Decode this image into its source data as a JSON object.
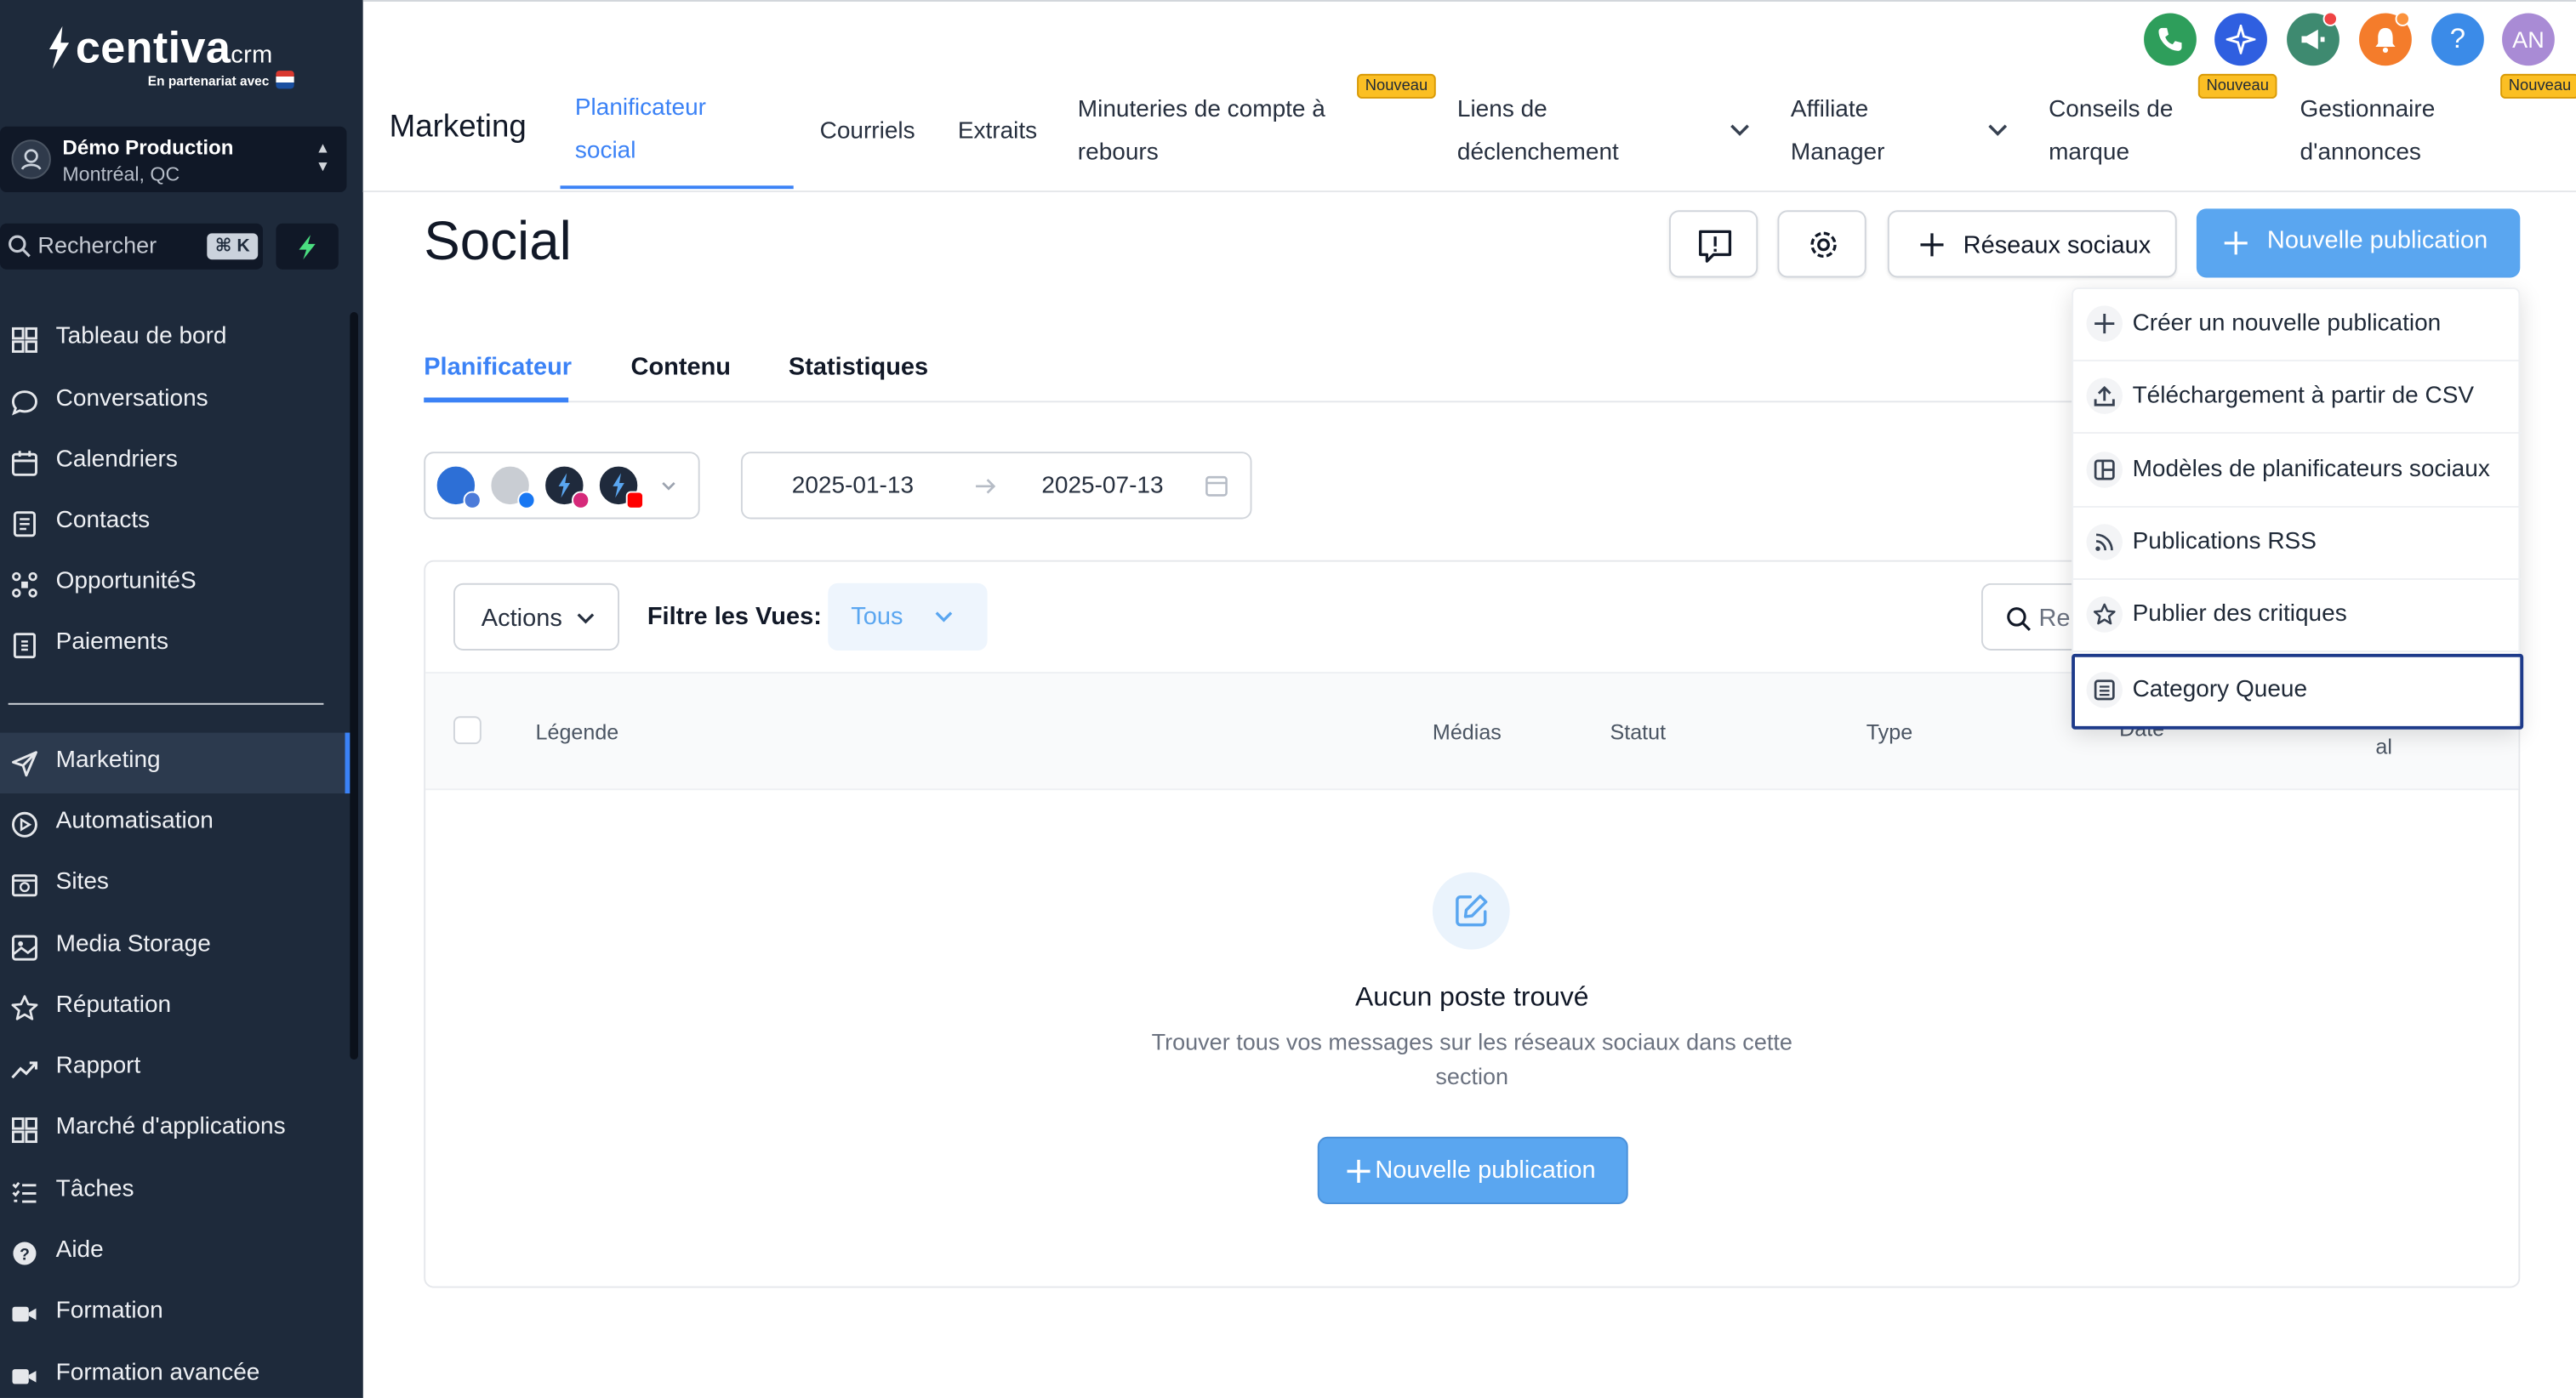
{
  "brand": {
    "name": "centiva",
    "suffix": "crm",
    "tagline": "En partenariat avec"
  },
  "account": {
    "name": "Démo Production",
    "location": "Montréal, QC"
  },
  "search": {
    "label": "Rechercher",
    "shortcut": "⌘ K"
  },
  "sidebar": {
    "items": [
      {
        "label": "Tableau de bord",
        "icon": "dashboard-icon"
      },
      {
        "label": "Conversations",
        "icon": "chat-icon"
      },
      {
        "label": "Calendriers",
        "icon": "calendar-icon"
      },
      {
        "label": "Contacts",
        "icon": "contacts-icon"
      },
      {
        "label": "OpportunitéS",
        "icon": "opportunities-icon"
      },
      {
        "label": "Paiements",
        "icon": "payments-icon"
      },
      {
        "label": "Marketing",
        "icon": "send-icon",
        "active": true
      },
      {
        "label": "Automatisation",
        "icon": "automation-icon"
      },
      {
        "label": "Sites",
        "icon": "sites-icon"
      },
      {
        "label": "Media Storage",
        "icon": "image-icon"
      },
      {
        "label": "Réputation",
        "icon": "star-icon"
      },
      {
        "label": "Rapport",
        "icon": "trend-icon"
      },
      {
        "label": "Marché d'applications",
        "icon": "apps-icon"
      },
      {
        "label": "Tâches",
        "icon": "tasks-icon"
      },
      {
        "label": "Aide",
        "icon": "help-icon"
      },
      {
        "label": "Formation",
        "icon": "video-icon"
      },
      {
        "label": "Formation avancée",
        "icon": "video-icon"
      }
    ]
  },
  "header": {
    "section_title": "Marketing",
    "tabs": [
      {
        "label": "Planificateur social",
        "active": true
      },
      {
        "label": "Courriels"
      },
      {
        "label": "Extraits"
      },
      {
        "label": "Minuteries de compte à rebours",
        "badge": "Nouveau"
      },
      {
        "label": "Liens de déclenchement",
        "dropdown": true
      },
      {
        "label": "Affiliate Manager",
        "dropdown": true
      },
      {
        "label": "Conseils de marque",
        "badge": "Nouveau"
      },
      {
        "label": "Gestionnaire d'annonces",
        "badge": "Nouveau"
      }
    ],
    "user_initials": "AN",
    "colors": {
      "phone": "#2e9e5b",
      "ai": "#2f5fe0",
      "megaphone": "#3e8a70",
      "bell": "#f47c2b",
      "help": "#3b8be8",
      "avatar": "#a98bd5"
    }
  },
  "page": {
    "title": "Social",
    "buttons": {
      "social_networks": "Réseaux sociaux",
      "new_post": "Nouvelle publication"
    },
    "subtabs": [
      "Planificateur",
      "Contenu",
      "Statistiques"
    ],
    "date_range": {
      "start": "2025-01-13",
      "end": "2025-07-13"
    },
    "toolbar": {
      "actions": "Actions",
      "filter_label": "Filtre les Vues:",
      "filter_value": "Tous",
      "search_placeholder": "Re"
    },
    "table_headers": [
      "Légende",
      "Médias",
      "Statut",
      "Type",
      "Date",
      "al"
    ],
    "empty": {
      "title": "Aucun poste trouvé",
      "description": "Trouver tous vos messages sur les réseaux sociaux dans cette section",
      "button": "Nouvelle publication"
    }
  },
  "dropdown": {
    "items": [
      {
        "label": "Créer un nouvelle publication",
        "icon": "plus-icon"
      },
      {
        "label": "Téléchargement à partir de CSV",
        "icon": "upload-icon"
      },
      {
        "label": "Modèles de planificateurs sociaux",
        "icon": "template-icon"
      },
      {
        "label": "Publications RSS",
        "icon": "rss-icon"
      },
      {
        "label": "Publier des critiques",
        "icon": "star-icon"
      },
      {
        "label": "Category Queue",
        "icon": "queue-icon",
        "focused": true
      }
    ]
  }
}
